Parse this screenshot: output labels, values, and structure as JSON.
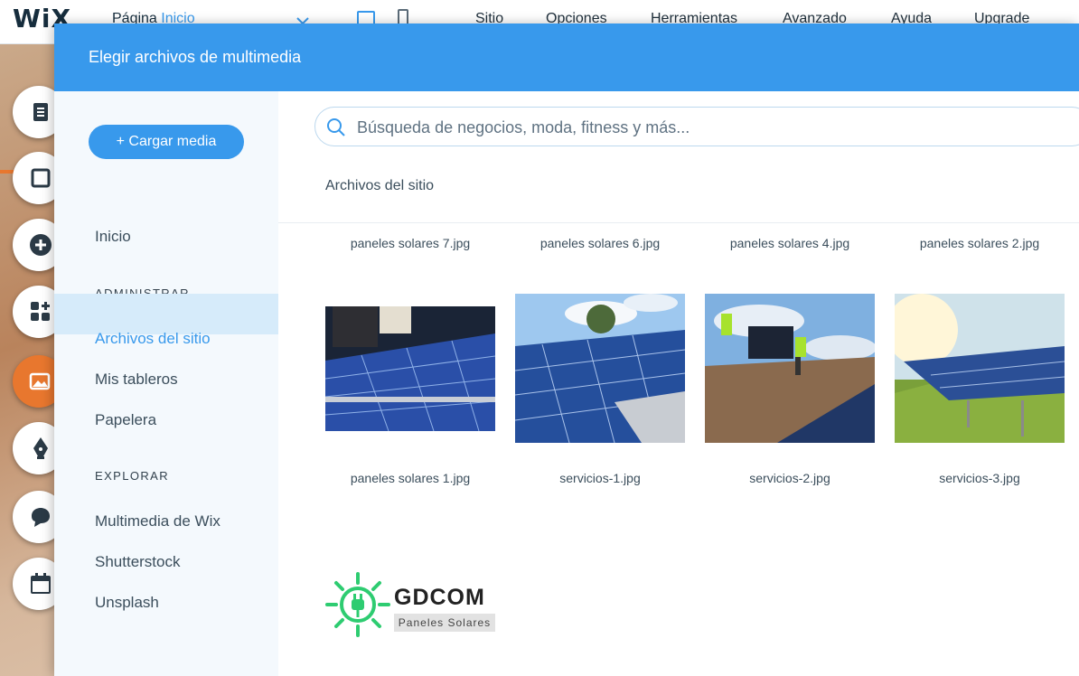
{
  "editor": {
    "logo": "WiX",
    "page_label": "Página",
    "page_name": "Inicio",
    "menu": [
      "Sitio",
      "Opciones",
      "Herramientas",
      "Avanzado",
      "Ayuda",
      "Upgrade"
    ]
  },
  "dialog": {
    "title": "Elegir archivos de multimedia"
  },
  "sidebar": {
    "upload_label": "+ Cargar media",
    "home": "Inicio",
    "section_admin": "ADMINISTRAR",
    "admin_items": [
      "Archivos del sitio",
      "Mis tableros",
      "Papelera"
    ],
    "section_explore": "EXPLORAR",
    "explore_items": [
      "Multimedia de Wix",
      "Shutterstock",
      "Unsplash"
    ]
  },
  "search": {
    "placeholder": "Búsqueda de negocios, moda, fitness y más..."
  },
  "breadcrumb": "Archivos del sitio",
  "files_row1": [
    "paneles solares 7.jpg",
    "paneles solares 6.jpg",
    "paneles solares 4.jpg",
    "paneles solares 2.jpg"
  ],
  "files_row2": [
    "paneles solares 1.jpg",
    "servicios-1.jpg",
    "servicios-2.jpg",
    "servicios-3.jpg"
  ],
  "logo_file": {
    "name": "GDCOM",
    "subtitle": "Paneles Solares"
  },
  "colors": {
    "accent": "#3899ec",
    "active_item_bg": "#d6ebfa",
    "logo_green": "#2ecc71"
  }
}
